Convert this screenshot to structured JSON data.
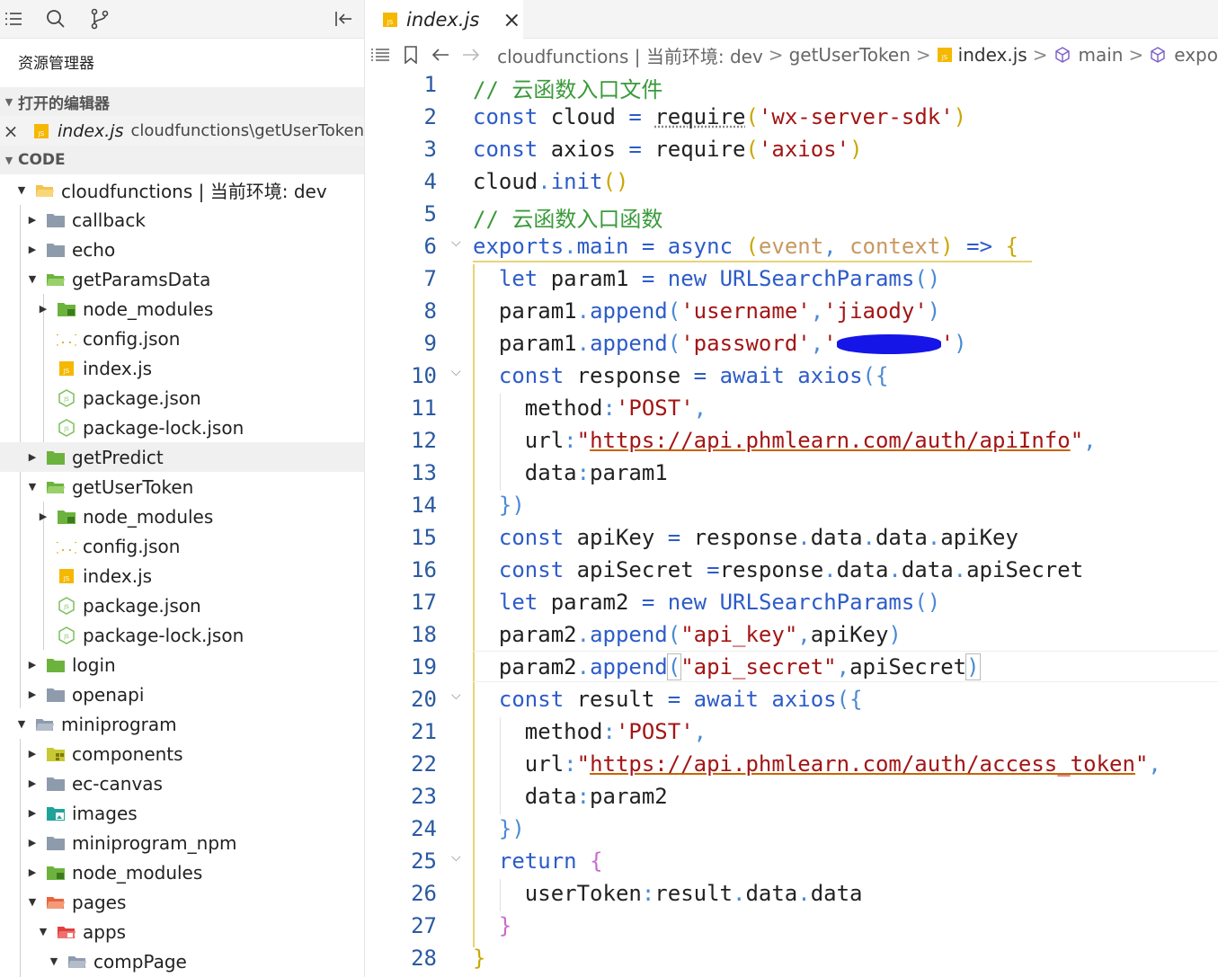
{
  "sidebar": {
    "explorer_title": "资源管理器",
    "open_editors_label": "打开的编辑器",
    "open_file": {
      "name": "index.js",
      "path": "cloudfunctions\\getUserToken"
    },
    "workspace_label": "CODE",
    "tree": [
      {
        "label": "cloudfunctions | 当前环境: dev"
      },
      {
        "label": "callback"
      },
      {
        "label": "echo"
      },
      {
        "label": "getParamsData"
      },
      {
        "label": "node_modules"
      },
      {
        "label": "config.json"
      },
      {
        "label": "index.js"
      },
      {
        "label": "package.json"
      },
      {
        "label": "package-lock.json"
      },
      {
        "label": "getPredict"
      },
      {
        "label": "getUserToken"
      },
      {
        "label": "node_modules"
      },
      {
        "label": "config.json"
      },
      {
        "label": "index.js"
      },
      {
        "label": "package.json"
      },
      {
        "label": "package-lock.json"
      },
      {
        "label": "login"
      },
      {
        "label": "openapi"
      },
      {
        "label": "miniprogram"
      },
      {
        "label": "components"
      },
      {
        "label": "ec-canvas"
      },
      {
        "label": "images"
      },
      {
        "label": "miniprogram_npm"
      },
      {
        "label": "node_modules"
      },
      {
        "label": "pages"
      },
      {
        "label": "apps"
      },
      {
        "label": "compPage"
      }
    ]
  },
  "tab": {
    "label": "index.js",
    "close": "×"
  },
  "breadcrumb": {
    "items": [
      "cloudfunctions | 当前环境: dev",
      "getUserToken",
      "index.js",
      "main",
      "expo"
    ],
    "sep": ">"
  },
  "editor": {
    "line_numbers": [
      "1",
      "2",
      "3",
      "4",
      "5",
      "6",
      "7",
      "8",
      "9",
      "10",
      "11",
      "12",
      "13",
      "14",
      "15",
      "16",
      "17",
      "18",
      "19",
      "20",
      "21",
      "22",
      "23",
      "24",
      "25",
      "26",
      "27",
      "28"
    ],
    "strings": {
      "comment1": "// 云函数入口文件",
      "comment2": "// 云函数入口函数",
      "sdk": "'wx-server-sdk'",
      "axios": "'axios'",
      "username_key": "'username'",
      "username_val": "'jiaody'",
      "password_key": "'password'",
      "post1": "'POST'",
      "url1": "https://api.phmlearn.com/auth/apiInfo",
      "api_key": "\"api_key\"",
      "api_secret": "\"api_secret\"",
      "post2": "'POST'",
      "url2": "https://api.phmlearn.com/auth/access_token"
    }
  },
  "colors": {
    "accent": "#2d5cc8",
    "string": "#a31515",
    "comment": "#3a9a3a",
    "brace": "#c8a800",
    "param": "#c89860"
  }
}
